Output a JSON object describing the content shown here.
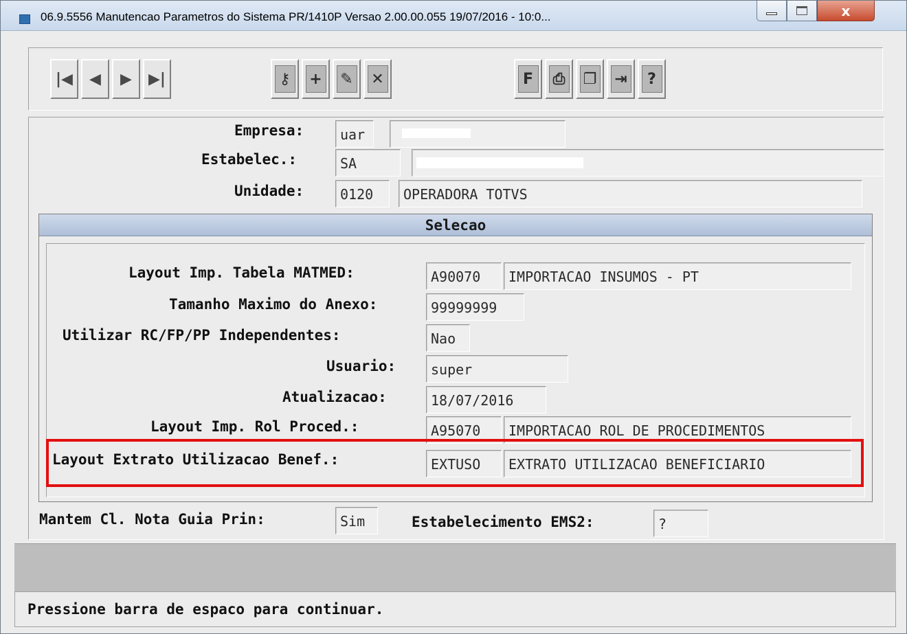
{
  "window": {
    "title": "06.9.5556 Manutencao  Parametros do Sistema PR/1410P Versao 2.00.00.055 19/07/2016 - 10:0...",
    "close_glyph": "x"
  },
  "toolbar": {
    "nav_buttons": [
      {
        "icon": "first-record-icon",
        "glyph": "|◀"
      },
      {
        "icon": "previous-record-icon",
        "glyph": "◀"
      },
      {
        "icon": "next-record-icon",
        "glyph": "▶"
      },
      {
        "icon": "last-record-icon",
        "glyph": "▶|"
      }
    ],
    "edit_buttons": [
      {
        "icon": "search-key-icon",
        "glyph": "⚷"
      },
      {
        "icon": "add-record-icon",
        "glyph": "+"
      },
      {
        "icon": "edit-record-icon",
        "glyph": "✎"
      },
      {
        "icon": "delete-record-icon",
        "glyph": "✕"
      }
    ],
    "action_buttons": [
      {
        "icon": "filter-icon",
        "glyph": "F"
      },
      {
        "icon": "print-icon",
        "glyph": "⎙"
      },
      {
        "icon": "copy-icon",
        "glyph": "❐"
      },
      {
        "icon": "exit-icon",
        "glyph": "⇥"
      },
      {
        "icon": "help-icon",
        "glyph": "?"
      }
    ]
  },
  "main": {
    "empresa_label": "Empresa:",
    "empresa_code": "uar",
    "estabelec_label": "Estabelec.:",
    "estabelec_code": "SA",
    "unidade_label": "Unidade:",
    "unidade_code": "0120",
    "unidade_name": "OPERADORA TOTVS",
    "mantem_label": "Mantem Cl. Nota Guia Prin:",
    "mantem_value": "Sim",
    "estab_ems2_label": "Estabelecimento EMS2:",
    "estab_ems2_value": "?"
  },
  "dialog": {
    "title": "Selecao",
    "rows": {
      "matmed_label": "Layout Imp. Tabela MATMED:",
      "matmed_code": "A90070",
      "matmed_desc": "IMPORTACAO INSUMOS - PT",
      "anexo_label": "Tamanho Maximo do Anexo:",
      "anexo_value": "99999999",
      "rcfp_label": "Utilizar RC/FP/PP Independentes:",
      "rcfp_value": "Nao",
      "usuario_label": "Usuario:",
      "usuario_value": "super",
      "atualiz_label": "Atualizacao:",
      "atualiz_value": "18/07/2016",
      "rol_label": "Layout Imp. Rol Proced.:",
      "rol_code": "A95070",
      "rol_desc": "IMPORTACAO ROL DE PROCEDIMENTOS",
      "extrato_label": "Layout Extrato Utilizacao Benef.:",
      "extrato_code": "EXTUSO",
      "extrato_desc": "EXTRATO UTILIZACAO BENEFICIARIO"
    }
  },
  "status": {
    "message": "Pressione barra de espaco para continuar."
  },
  "colors": {
    "highlight": "#e30f0f",
    "titlebar": "#c9d9ec",
    "dialog_title": "#aebfd8"
  }
}
